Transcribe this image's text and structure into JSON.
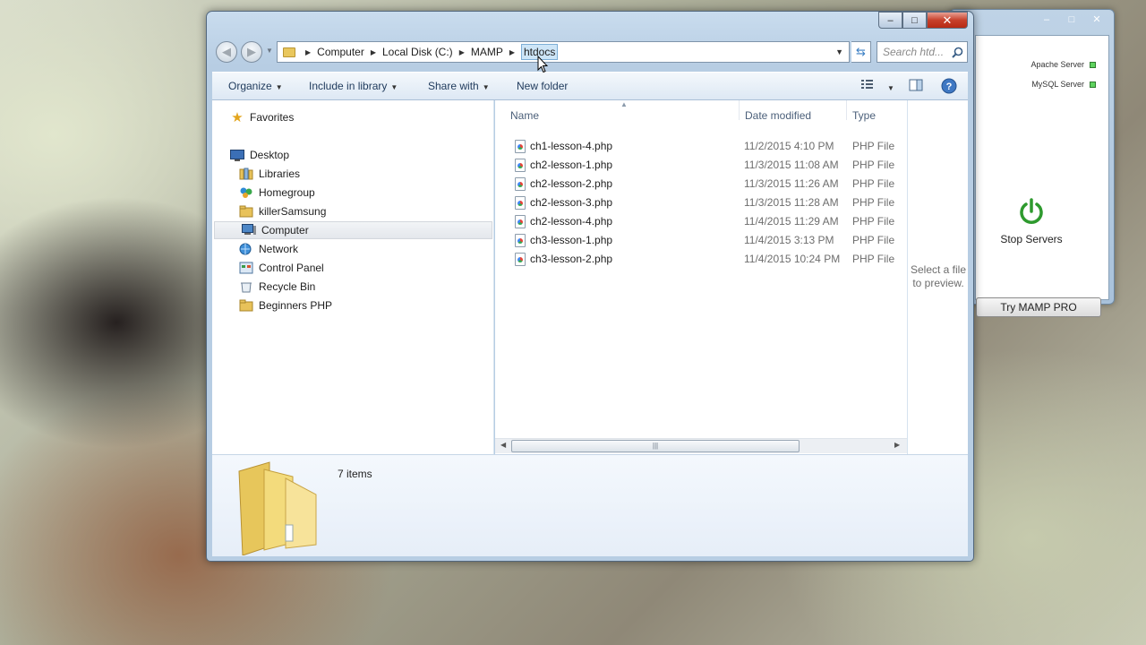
{
  "mamp": {
    "servers": [
      {
        "label": "Apache Server"
      },
      {
        "label": "MySQL Server"
      }
    ],
    "stop_label": "Stop Servers",
    "try_pro_label": "Try MAMP PRO"
  },
  "explorer": {
    "caption": {
      "minimize": "–",
      "maximize": "□",
      "close": "✕"
    },
    "breadcrumb": [
      "Computer",
      "Local Disk (C:)",
      "MAMP",
      "htdocs"
    ],
    "search_placeholder": "Search htd...",
    "toolbar": {
      "organize": "Organize",
      "include_in_library": "Include in library",
      "share_with": "Share with",
      "new_folder": "New folder"
    },
    "nav": {
      "favorites": "Favorites",
      "items": [
        {
          "label": "Desktop"
        },
        {
          "label": "Libraries"
        },
        {
          "label": "Homegroup"
        },
        {
          "label": "killerSamsung"
        },
        {
          "label": "Computer"
        },
        {
          "label": "Network"
        },
        {
          "label": "Control Panel"
        },
        {
          "label": "Recycle Bin"
        },
        {
          "label": "Beginners PHP"
        }
      ],
      "selected": "Computer"
    },
    "columns": {
      "name": "Name",
      "date_modified": "Date modified",
      "type": "Type"
    },
    "files": [
      {
        "name": "ch1-lesson-4.php",
        "date": "11/2/2015 4:10 PM",
        "type": "PHP File"
      },
      {
        "name": "ch2-lesson-1.php",
        "date": "11/3/2015 11:08 AM",
        "type": "PHP File"
      },
      {
        "name": "ch2-lesson-2.php",
        "date": "11/3/2015 11:26 AM",
        "type": "PHP File"
      },
      {
        "name": "ch2-lesson-3.php",
        "date": "11/3/2015 11:28 AM",
        "type": "PHP File"
      },
      {
        "name": "ch2-lesson-4.php",
        "date": "11/4/2015 11:29 AM",
        "type": "PHP File"
      },
      {
        "name": "ch3-lesson-1.php",
        "date": "11/4/2015 3:13 PM",
        "type": "PHP File"
      },
      {
        "name": "ch3-lesson-2.php",
        "date": "11/4/2015 10:24 PM",
        "type": "PHP File"
      }
    ],
    "preview_text_line1": "Select a file",
    "preview_text_line2": "to preview.",
    "details": {
      "items_count": "7 items"
    }
  }
}
